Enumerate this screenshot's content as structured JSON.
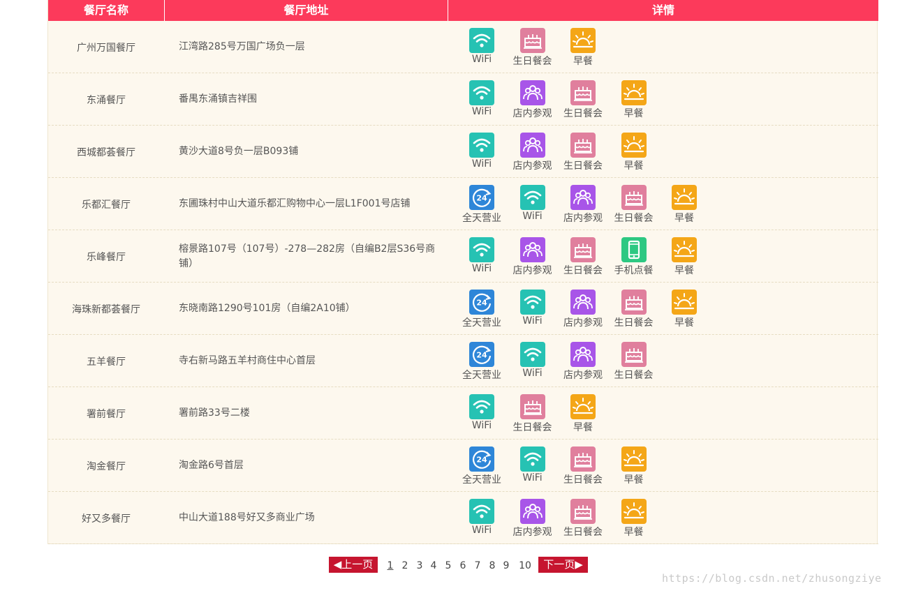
{
  "header": {
    "name": "餐厅名称",
    "address": "餐厅地址",
    "detail": "详情"
  },
  "colors": {
    "header_bg": "#fc3a5b",
    "table_bg": "#fdf8ee",
    "pager_bg": "#c6152f",
    "wifi": "#26c2b3",
    "visit": "#a855e8",
    "birthday": "#e07f9d",
    "breakfast": "#f4a617",
    "allday": "#2e86d8",
    "mobile": "#2dc882"
  },
  "features": {
    "allday": {
      "label": "全天营业",
      "icon": "clock-24-icon"
    },
    "wifi": {
      "label": "WiFi",
      "icon": "wifi-icon"
    },
    "visit": {
      "label": "店内参观",
      "icon": "people-icon"
    },
    "birthday": {
      "label": "生日餐会",
      "icon": "cake-icon"
    },
    "mobile": {
      "label": "手机点餐",
      "icon": "phone-icon"
    },
    "breakfast": {
      "label": "早餐",
      "icon": "sunrise-icon"
    }
  },
  "rows": [
    {
      "name": "广州万国餐厅",
      "address": "江湾路285号万国广场负一层",
      "features": [
        "wifi",
        "birthday",
        "breakfast"
      ]
    },
    {
      "name": "东涌餐厅",
      "address": "番禺东涌镇吉祥围",
      "features": [
        "wifi",
        "visit",
        "birthday",
        "breakfast"
      ]
    },
    {
      "name": "西城都荟餐厅",
      "address": "黄沙大道8号负一层B093铺",
      "features": [
        "wifi",
        "visit",
        "birthday",
        "breakfast"
      ]
    },
    {
      "name": "乐都汇餐厅",
      "address": "东圃珠村中山大道乐都汇购物中心一层L1F001号店铺",
      "features": [
        "allday",
        "wifi",
        "visit",
        "birthday",
        "breakfast"
      ]
    },
    {
      "name": "乐峰餐厅",
      "address": "榕景路107号（107号）-278—282房（自编B2层S36号商铺）",
      "features": [
        "wifi",
        "visit",
        "birthday",
        "mobile",
        "breakfast"
      ]
    },
    {
      "name": "海珠新都荟餐厅",
      "address": "东晓南路1290号101房（自编2A10铺）",
      "features": [
        "allday",
        "wifi",
        "visit",
        "birthday",
        "breakfast"
      ]
    },
    {
      "name": "五羊餐厅",
      "address": "寺右新马路五羊村商住中心首层",
      "features": [
        "allday",
        "wifi",
        "visit",
        "birthday"
      ]
    },
    {
      "name": "署前餐厅",
      "address": "署前路33号二楼",
      "features": [
        "wifi",
        "birthday",
        "breakfast"
      ]
    },
    {
      "name": "淘金餐厅",
      "address": "淘金路6号首层",
      "features": [
        "allday",
        "wifi",
        "birthday",
        "breakfast"
      ]
    },
    {
      "name": "好又多餐厅",
      "address": "中山大道188号好又多商业广场",
      "features": [
        "wifi",
        "visit",
        "birthday",
        "breakfast"
      ]
    }
  ],
  "pagination": {
    "prev": "◀上一页",
    "next": "下一页▶",
    "pages": [
      "1",
      "2",
      "3",
      "4",
      "5",
      "6",
      "7",
      "8",
      "9",
      "10"
    ],
    "current": "1"
  },
  "watermark": "https://blog.csdn.net/zhusongziye"
}
